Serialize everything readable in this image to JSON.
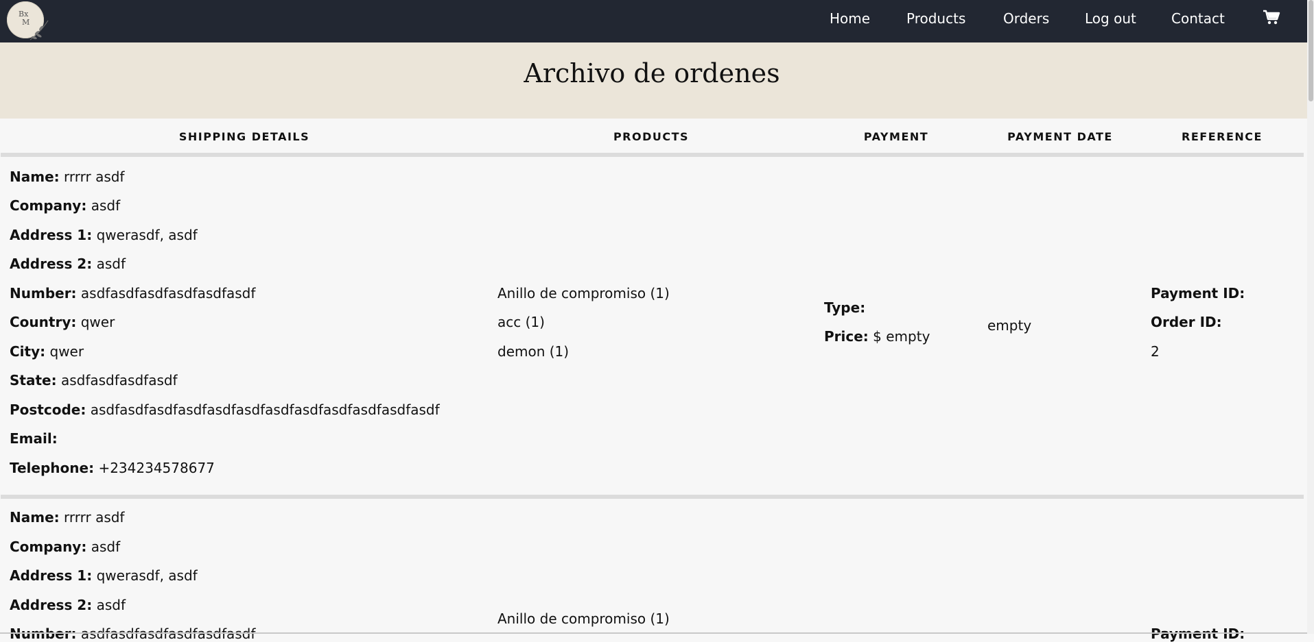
{
  "brand": {
    "logo_line1": "Bx",
    "logo_line2": "M",
    "logo_icon": "leaf-sprig-icon"
  },
  "nav": {
    "items": [
      {
        "label": "Home"
      },
      {
        "label": "Products"
      },
      {
        "label": "Orders"
      },
      {
        "label": "Log out"
      },
      {
        "label": "Contact"
      }
    ],
    "cart_icon": "shopping-cart-icon"
  },
  "page": {
    "title": "Archivo de ordenes"
  },
  "table": {
    "headers": [
      "SHIPPING DETAILS",
      "PRODUCTS",
      "PAYMENT",
      "PAYMENT DATE",
      "REFERENCE"
    ],
    "orders": [
      {
        "shipping": [
          {
            "label": "Name:",
            "value": "rrrrr asdf"
          },
          {
            "label": "Company:",
            "value": "asdf"
          },
          {
            "label": "Address 1:",
            "value": "qwerasdf, asdf"
          },
          {
            "label": "Address 2:",
            "value": "asdf"
          },
          {
            "label": "Number:",
            "value": "asdfasdfasdfasdfasdfasdf"
          },
          {
            "label": "Country:",
            "value": "qwer"
          },
          {
            "label": "City:",
            "value": "qwer"
          },
          {
            "label": "State:",
            "value": "asdfasdfasdfasdf"
          },
          {
            "label": "Postcode:",
            "value": "asdfasdfasdfasdfasdfasdfasdfasdfasdfasdfasdfasdf"
          },
          {
            "label": "Email:",
            "value": ""
          },
          {
            "label": "Telephone:",
            "value": "+234234578677"
          }
        ],
        "products": [
          "Anillo de compromiso (1)",
          "acc (1)",
          "demon (1)"
        ],
        "payment": {
          "type_label": "Type:",
          "type_value": "",
          "price_label": "Price:",
          "price_value": "$ empty"
        },
        "payment_date": "empty",
        "reference": {
          "payment_id_label": "Payment ID:",
          "order_id_label": "Order ID:",
          "order_id": "2"
        }
      },
      {
        "shipping": [
          {
            "label": "Name:",
            "value": "rrrrr asdf"
          },
          {
            "label": "Company:",
            "value": "asdf"
          },
          {
            "label": "Address 1:",
            "value": "qwerasdf, asdf"
          },
          {
            "label": "Address 2:",
            "value": "asdf"
          },
          {
            "label": "Number:",
            "value": "asdfasdfasdfasdfasdfasdf"
          }
        ],
        "products": [
          "Anillo de compromiso (1)"
        ],
        "reference": {
          "payment_id_label": "Payment ID:"
        }
      }
    ]
  },
  "colors": {
    "navbar": "#222732",
    "title_band": "#ebe5d9",
    "row_bg": "#f7f7f7",
    "divider": "#dcdcdc"
  }
}
